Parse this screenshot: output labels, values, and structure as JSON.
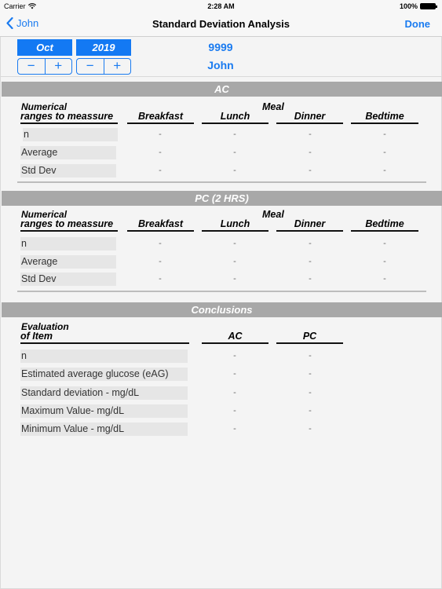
{
  "status_bar": {
    "carrier": "Carrier",
    "wifi_icon": "wifi-icon",
    "time": "2:28 AM",
    "battery_percent": "100%",
    "battery_icon": "battery-icon"
  },
  "nav": {
    "back_label": "John",
    "back_icon": "chevron-left-icon",
    "title": "Standard Deviation Analysis",
    "done_label": "Done"
  },
  "pickers": {
    "month": {
      "value": "Oct",
      "minus": "−",
      "plus": "+"
    },
    "year": {
      "value": "2019",
      "minus": "−",
      "plus": "+"
    }
  },
  "patient": {
    "id": "9999",
    "name": "John"
  },
  "ac_section": {
    "title": "AC",
    "row_header_line1": "Numerical",
    "row_header_line2": "ranges to meassure",
    "group_label": "Meal",
    "columns": [
      "Breakfast",
      "Lunch",
      "Dinner",
      "Bedtime"
    ],
    "rows": [
      {
        "label": "n",
        "values": [
          "-",
          "-",
          "-",
          "-"
        ]
      },
      {
        "label": "Average",
        "values": [
          "-",
          "-",
          "-",
          "-"
        ]
      },
      {
        "label": "Std Dev",
        "values": [
          "-",
          "-",
          "-",
          "-"
        ]
      }
    ]
  },
  "pc_section": {
    "title": "PC (2 HRS)",
    "row_header_line1": "Numerical",
    "row_header_line2": "ranges to meassure",
    "group_label": "Meal",
    "columns": [
      "Breakfast",
      "Lunch",
      "Dinner",
      "Bedtime"
    ],
    "rows": [
      {
        "label": "n",
        "values": [
          "-",
          "-",
          "-",
          "-"
        ]
      },
      {
        "label": "Average",
        "values": [
          "-",
          "-",
          "-",
          "-"
        ]
      },
      {
        "label": "Std Dev",
        "values": [
          "-",
          "-",
          "-",
          "-"
        ]
      }
    ]
  },
  "conclusions": {
    "title": "Conclusions",
    "row_header_line1": "Evaluation",
    "row_header_line2": "of Item",
    "columns": [
      "AC",
      "PC"
    ],
    "rows": [
      {
        "label": "n",
        "values": [
          "-",
          "-"
        ]
      },
      {
        "label": "Estimated average glucose (eAG)",
        "values": [
          "-",
          "-"
        ]
      },
      {
        "label": "Standard deviation - mg/dL",
        "values": [
          "-",
          "-"
        ]
      },
      {
        "label": "Maximum Value- mg/dL",
        "values": [
          "-",
          "-"
        ]
      },
      {
        "label": "Minimum Value - mg/dL",
        "values": [
          "-",
          "-"
        ]
      }
    ]
  },
  "colors": {
    "accent": "#1a7bf0",
    "picker_fill": "#1379f3",
    "section_bar": "#a8a8a8",
    "background": "#f4f4f4"
  }
}
